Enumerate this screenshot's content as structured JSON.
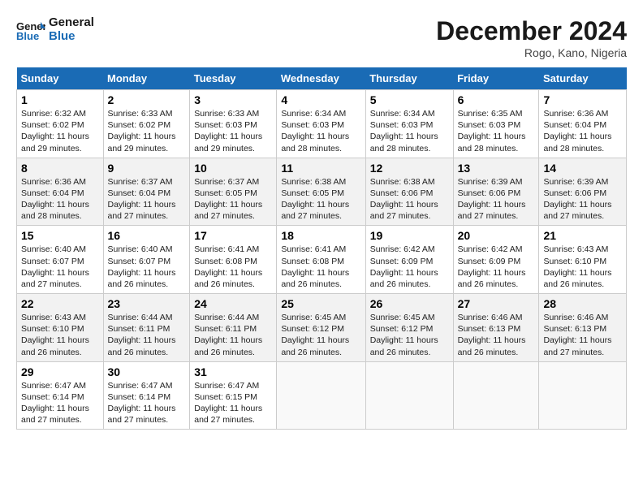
{
  "header": {
    "logo_general": "General",
    "logo_blue": "Blue",
    "month_title": "December 2024",
    "location": "Rogo, Kano, Nigeria"
  },
  "days_of_week": [
    "Sunday",
    "Monday",
    "Tuesday",
    "Wednesday",
    "Thursday",
    "Friday",
    "Saturday"
  ],
  "weeks": [
    [
      {
        "day": "1",
        "info": "Sunrise: 6:32 AM\nSunset: 6:02 PM\nDaylight: 11 hours and 29 minutes."
      },
      {
        "day": "2",
        "info": "Sunrise: 6:33 AM\nSunset: 6:02 PM\nDaylight: 11 hours and 29 minutes."
      },
      {
        "day": "3",
        "info": "Sunrise: 6:33 AM\nSunset: 6:03 PM\nDaylight: 11 hours and 29 minutes."
      },
      {
        "day": "4",
        "info": "Sunrise: 6:34 AM\nSunset: 6:03 PM\nDaylight: 11 hours and 28 minutes."
      },
      {
        "day": "5",
        "info": "Sunrise: 6:34 AM\nSunset: 6:03 PM\nDaylight: 11 hours and 28 minutes."
      },
      {
        "day": "6",
        "info": "Sunrise: 6:35 AM\nSunset: 6:03 PM\nDaylight: 11 hours and 28 minutes."
      },
      {
        "day": "7",
        "info": "Sunrise: 6:36 AM\nSunset: 6:04 PM\nDaylight: 11 hours and 28 minutes."
      }
    ],
    [
      {
        "day": "8",
        "info": "Sunrise: 6:36 AM\nSunset: 6:04 PM\nDaylight: 11 hours and 28 minutes."
      },
      {
        "day": "9",
        "info": "Sunrise: 6:37 AM\nSunset: 6:04 PM\nDaylight: 11 hours and 27 minutes."
      },
      {
        "day": "10",
        "info": "Sunrise: 6:37 AM\nSunset: 6:05 PM\nDaylight: 11 hours and 27 minutes."
      },
      {
        "day": "11",
        "info": "Sunrise: 6:38 AM\nSunset: 6:05 PM\nDaylight: 11 hours and 27 minutes."
      },
      {
        "day": "12",
        "info": "Sunrise: 6:38 AM\nSunset: 6:06 PM\nDaylight: 11 hours and 27 minutes."
      },
      {
        "day": "13",
        "info": "Sunrise: 6:39 AM\nSunset: 6:06 PM\nDaylight: 11 hours and 27 minutes."
      },
      {
        "day": "14",
        "info": "Sunrise: 6:39 AM\nSunset: 6:06 PM\nDaylight: 11 hours and 27 minutes."
      }
    ],
    [
      {
        "day": "15",
        "info": "Sunrise: 6:40 AM\nSunset: 6:07 PM\nDaylight: 11 hours and 27 minutes."
      },
      {
        "day": "16",
        "info": "Sunrise: 6:40 AM\nSunset: 6:07 PM\nDaylight: 11 hours and 26 minutes."
      },
      {
        "day": "17",
        "info": "Sunrise: 6:41 AM\nSunset: 6:08 PM\nDaylight: 11 hours and 26 minutes."
      },
      {
        "day": "18",
        "info": "Sunrise: 6:41 AM\nSunset: 6:08 PM\nDaylight: 11 hours and 26 minutes."
      },
      {
        "day": "19",
        "info": "Sunrise: 6:42 AM\nSunset: 6:09 PM\nDaylight: 11 hours and 26 minutes."
      },
      {
        "day": "20",
        "info": "Sunrise: 6:42 AM\nSunset: 6:09 PM\nDaylight: 11 hours and 26 minutes."
      },
      {
        "day": "21",
        "info": "Sunrise: 6:43 AM\nSunset: 6:10 PM\nDaylight: 11 hours and 26 minutes."
      }
    ],
    [
      {
        "day": "22",
        "info": "Sunrise: 6:43 AM\nSunset: 6:10 PM\nDaylight: 11 hours and 26 minutes."
      },
      {
        "day": "23",
        "info": "Sunrise: 6:44 AM\nSunset: 6:11 PM\nDaylight: 11 hours and 26 minutes."
      },
      {
        "day": "24",
        "info": "Sunrise: 6:44 AM\nSunset: 6:11 PM\nDaylight: 11 hours and 26 minutes."
      },
      {
        "day": "25",
        "info": "Sunrise: 6:45 AM\nSunset: 6:12 PM\nDaylight: 11 hours and 26 minutes."
      },
      {
        "day": "26",
        "info": "Sunrise: 6:45 AM\nSunset: 6:12 PM\nDaylight: 11 hours and 26 minutes."
      },
      {
        "day": "27",
        "info": "Sunrise: 6:46 AM\nSunset: 6:13 PM\nDaylight: 11 hours and 26 minutes."
      },
      {
        "day": "28",
        "info": "Sunrise: 6:46 AM\nSunset: 6:13 PM\nDaylight: 11 hours and 27 minutes."
      }
    ],
    [
      {
        "day": "29",
        "info": "Sunrise: 6:47 AM\nSunset: 6:14 PM\nDaylight: 11 hours and 27 minutes."
      },
      {
        "day": "30",
        "info": "Sunrise: 6:47 AM\nSunset: 6:14 PM\nDaylight: 11 hours and 27 minutes."
      },
      {
        "day": "31",
        "info": "Sunrise: 6:47 AM\nSunset: 6:15 PM\nDaylight: 11 hours and 27 minutes."
      },
      {
        "day": "",
        "info": ""
      },
      {
        "day": "",
        "info": ""
      },
      {
        "day": "",
        "info": ""
      },
      {
        "day": "",
        "info": ""
      }
    ]
  ]
}
